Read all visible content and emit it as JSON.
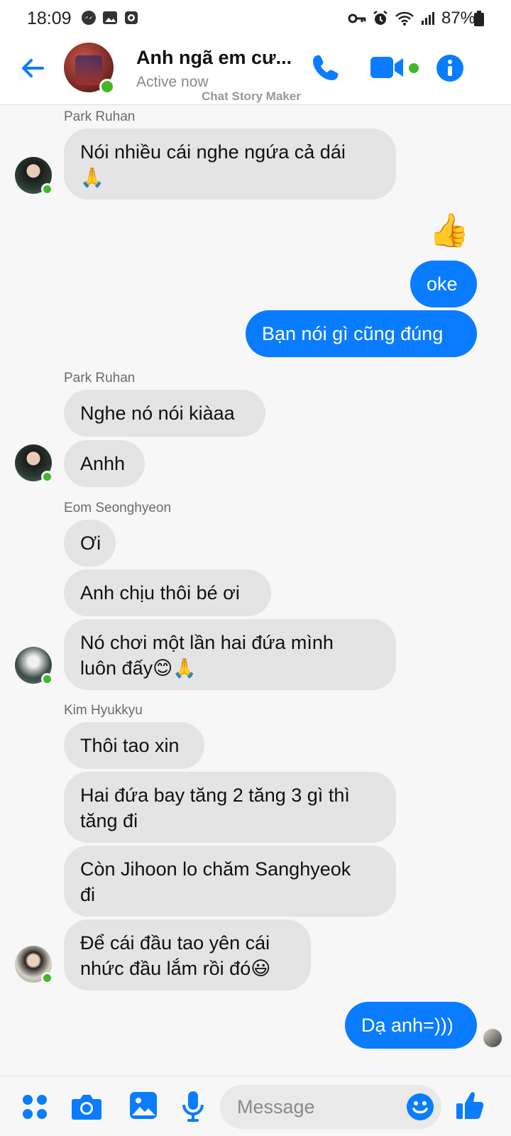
{
  "status_bar": {
    "time": "18:09",
    "battery": "87%",
    "left_icons": [
      "messenger-icon",
      "gallery-icon",
      "media-icon"
    ],
    "right_icons": [
      "key-icon",
      "alarm-icon",
      "wifi-icon",
      "signal-icon",
      "battery-icon"
    ]
  },
  "header": {
    "title": "Anh ngã em cư...",
    "status": "Active now",
    "watermark": "Chat Story Maker",
    "accent": "#0a7cff",
    "online_color": "#42b72a"
  },
  "messages": {
    "s1": "Park Ruhan",
    "m1": "Nói nhiều cái nghe ngứa cả dái",
    "m1_emoji": "🙏",
    "reaction": "👍",
    "m2": "oke",
    "m3": "Bạn nói gì cũng đúng",
    "s2": "Park Ruhan",
    "m4": "Nghe nó nói kiàaa",
    "m5": "Anhh",
    "s3": "Eom Seonghyeon",
    "m6": "Ơi",
    "m7": "Anh chịu thôi bé ơi",
    "m8_l1": "Nó chơi một lần hai đứa mình",
    "m8_l2": "luôn đấy😊🙏",
    "s4": "Kim Hyukkyu",
    "m9": "Thôi tao xin",
    "m10_l1": "Hai đứa bay tăng 2 tăng 3 gì thì",
    "m10_l2": "tăng đi",
    "m11_l1": "Còn Jihoon lo chăm Sanghyeok",
    "m11_l2": "đi",
    "m12_l1": "Để cái đầu tao yên cái",
    "m12_l2": "nhức đầu lắm rồi đó😃",
    "m13": "Dạ anh=)))"
  },
  "composer": {
    "placeholder": "Message"
  }
}
